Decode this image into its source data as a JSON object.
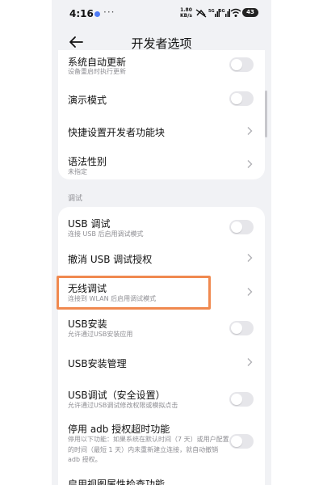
{
  "status_bar": {
    "time": "4:16",
    "more": "···",
    "net_speed_value": "1.80",
    "net_speed_unit": "KB/s",
    "signal1": "5G",
    "signal2": "5G",
    "battery": "43"
  },
  "header": {
    "title": "开发者选项"
  },
  "top_items": [
    {
      "title": "系统自动更新",
      "subtitle": "设备重启时执行更新"
    },
    {
      "title": "演示模式"
    },
    {
      "title": "快捷设置开发者功能块"
    },
    {
      "title": "语法性别",
      "subtitle": "未指定"
    }
  ],
  "section_label": "调试",
  "debug_items": [
    {
      "title": "USB 调试",
      "subtitle": "连接 USB 后启用调试模式"
    },
    {
      "title": "撤消 USB 调试授权"
    },
    {
      "title": "无线调试",
      "subtitle": "连接到 WLAN 后启用调试模式"
    },
    {
      "title": "USB安装",
      "subtitle": "允许通过USB安装应用"
    },
    {
      "title": "USB安装管理"
    },
    {
      "title": "USB调试（安全设置）",
      "subtitle": "允许通过USB调试修改权限或模拟点击"
    },
    {
      "title": "停用 adb 授权超时功能",
      "description": "停用以下功能：如果系统在默认时间（7 天）或用户配置的时间（最短 1 天）内未重新建立连接，就自动撤销 adb 授权。"
    },
    {
      "title": "启用视图属性检查功能"
    }
  ],
  "colors": {
    "highlight": "#f0894f",
    "background": "#f1f2f5",
    "toggle_off": "#e6e6ea"
  }
}
